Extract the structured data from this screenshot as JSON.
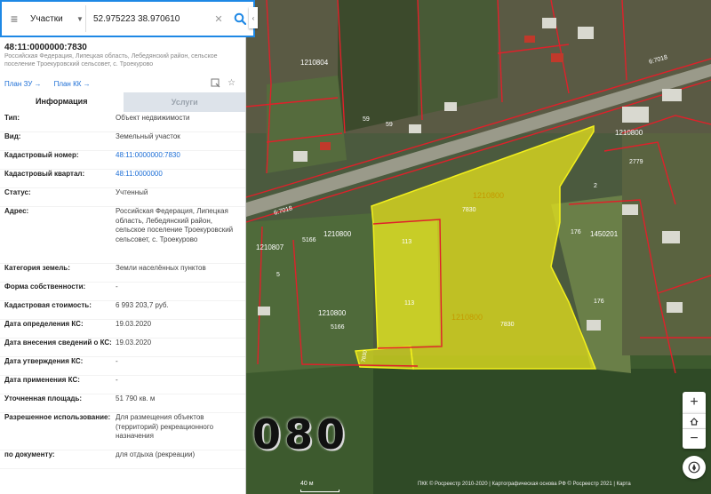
{
  "search": {
    "layer": "Участки",
    "query": "52.975223 38.970610"
  },
  "object": {
    "cadastral_number": "48:11:0000000:7830",
    "address_short": "Российская Федерация, Липецкая область, Лебедянский район, сельское поселение Троекуровский сельсовет, с. Троекурово",
    "plan_zu": "План ЗУ →",
    "plan_kk": "План КК →"
  },
  "tabs": {
    "info": "Информация",
    "services": "Услуги"
  },
  "rows": [
    {
      "key": "Тип:",
      "value": "Объект недвижимости"
    },
    {
      "key": "Вид:",
      "value": "Земельный участок"
    },
    {
      "key": "Кадастровый номер:",
      "value": "48:11:0000000:7830"
    },
    {
      "key": "Кадастровый квартал:",
      "value": "48:11:0000000"
    },
    {
      "key": "Статус:",
      "value": "Учтенный"
    },
    {
      "key": "Адрес:",
      "value": "Российская Федерация, Липецкая область, Лебедянский район, сельское поселение Троекуровский сельсовет, с. Троекурово"
    },
    {
      "key": "Категория земель:",
      "value": "Земли населённых пунктов"
    },
    {
      "key": "Форма собственности:",
      "value": "-"
    },
    {
      "key": "Кадастровая стоимость:",
      "value": "6 993 203,7 руб."
    },
    {
      "key": "Дата определения КС:",
      "value": "19.03.2020"
    },
    {
      "key": "Дата внесения сведений о КС:",
      "value": "19.03.2020"
    },
    {
      "key": "Дата утверждения КС:",
      "value": "-"
    },
    {
      "key": "Дата применения КС:",
      "value": "-"
    },
    {
      "key": "Уточненная площадь:",
      "value": "51 790 кв. м"
    },
    {
      "key": "Разрешенное использование:",
      "value": "Для размещения объектов (территорий) рекреационного назначения"
    },
    {
      "key": "по документу:",
      "value": "для отдыха (рекреации)"
    }
  ],
  "map_labels": {
    "parcel_main": "7830",
    "parcel_main_2": "7830",
    "parcel_small": "7830",
    "quarter_a": "1210800",
    "quarter_b": "1210800",
    "quarter_c": "1210800",
    "quarter_d": "1210800",
    "quarter_top": "1210804",
    "quarter_right": "1210800",
    "quarter_left": "1210807",
    "quarter_e": "1450201",
    "road_label": "6:7018",
    "road_label_2": "6:7018",
    "n113": "113",
    "n113b": "113",
    "n5166": "5166",
    "n5166b": "5166",
    "n176": "176",
    "n176b": "176",
    "n59": "59",
    "n59b": "59",
    "n2779": "2779",
    "n2": "2",
    "n5": "5"
  },
  "watermark": "080",
  "scale_label": "40 м",
  "attribution": "ПКК © Росреестр 2010-2020 | Картографическая основа РФ © Росреестр 2021 | Карта",
  "colors": {
    "accent": "#1e88e5",
    "parcel_fill": "#e6e31c",
    "boundary": "#e0202a"
  },
  "icons": {
    "menu": "menu-icon",
    "search": "search-icon",
    "clear": "close-icon",
    "print": "print-icon",
    "favorite": "star-icon",
    "zoom_in": "plus-icon",
    "home": "house-icon",
    "zoom_out": "minus-icon",
    "locate": "compass-icon"
  }
}
